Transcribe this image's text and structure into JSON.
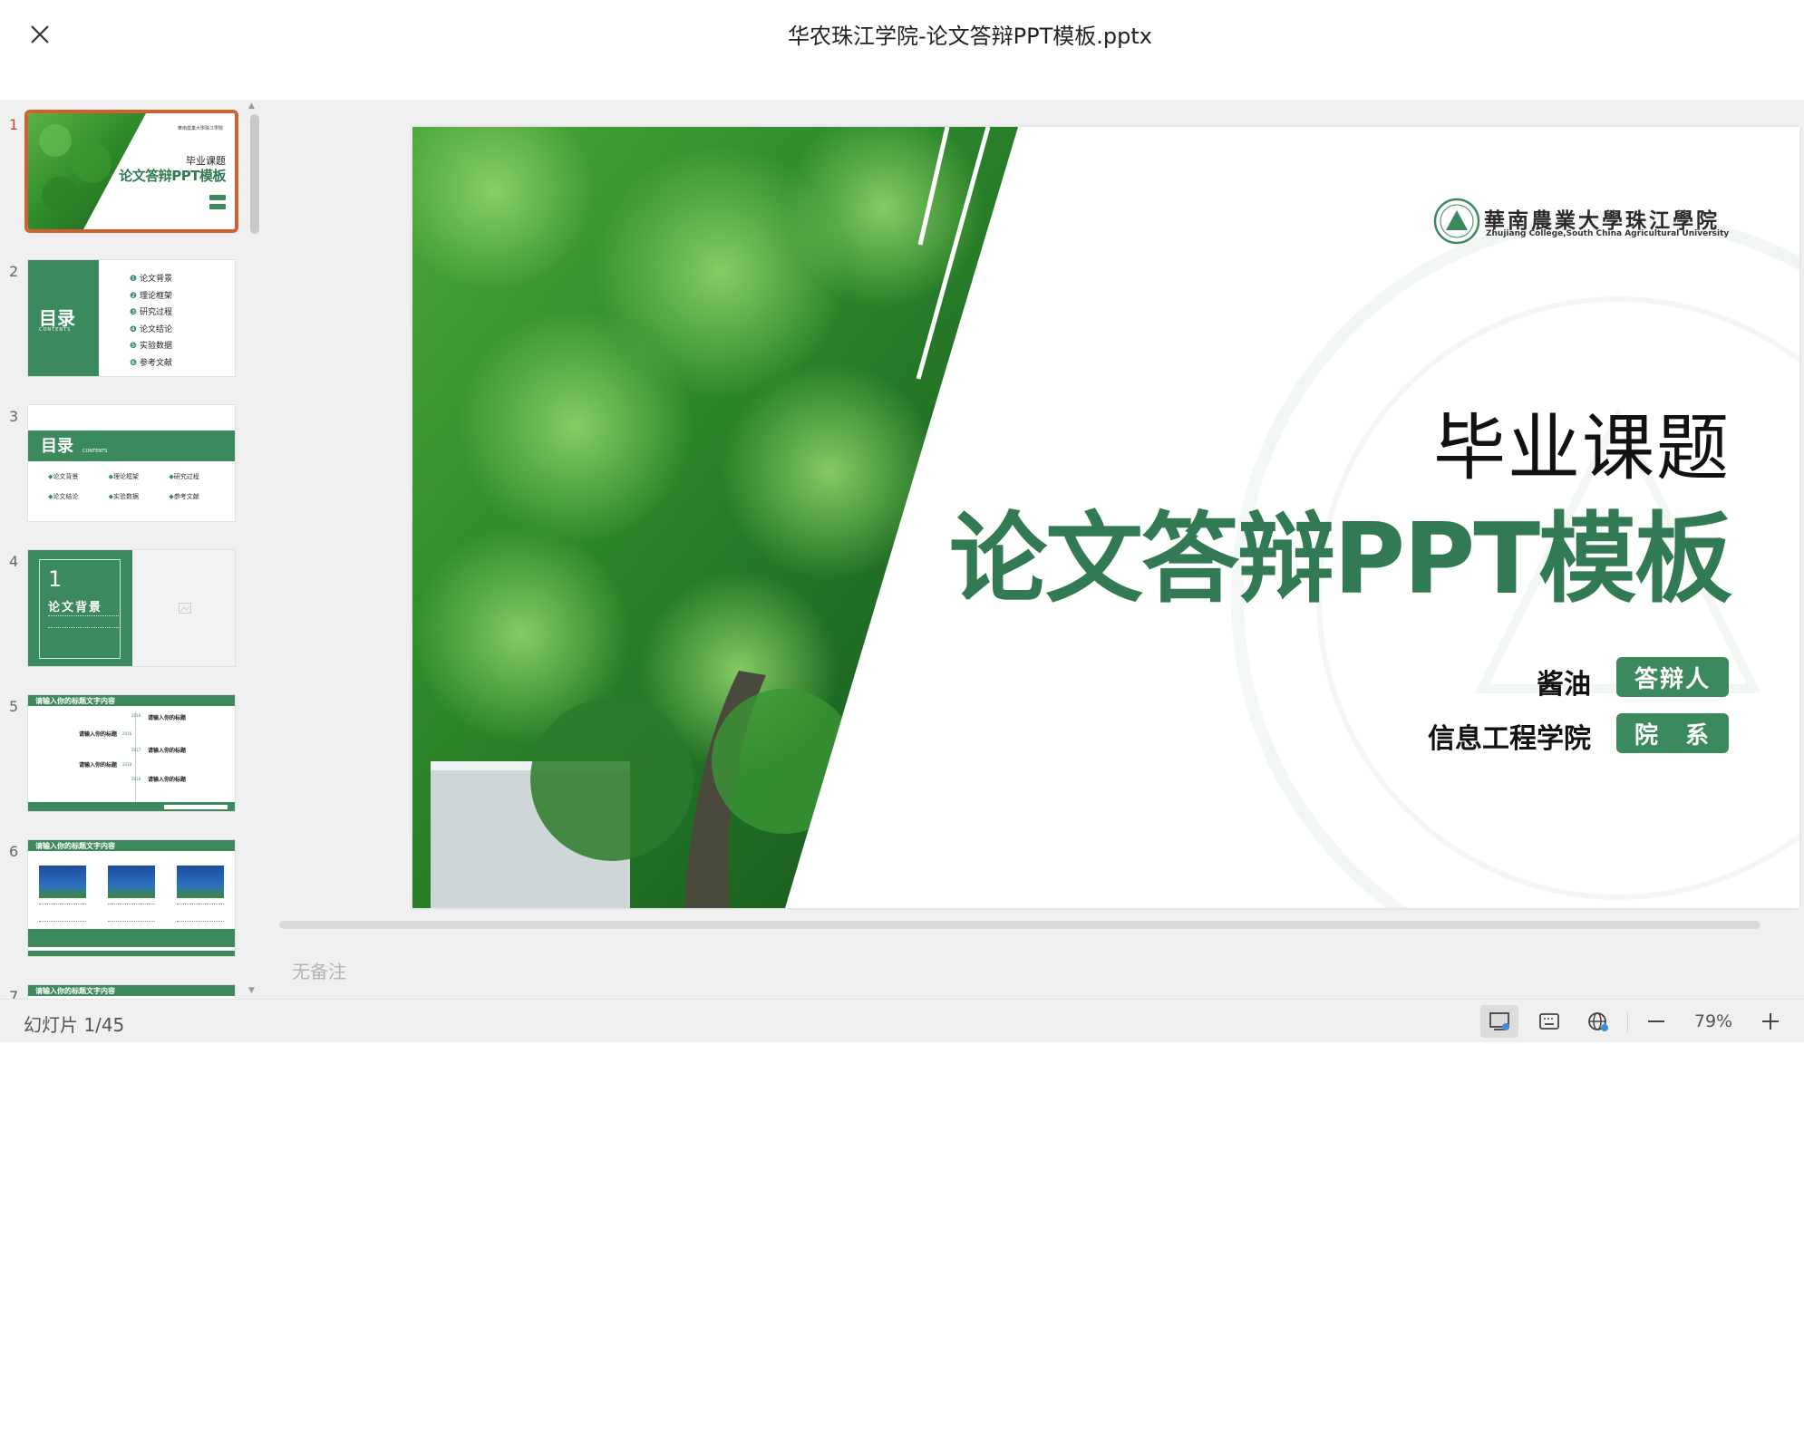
{
  "window": {
    "title": "华农珠江学院-论文答辩PPT模板.pptx",
    "close_icon": "close-icon"
  },
  "thumbnails": [
    {
      "num": "1",
      "label": "毕业课题",
      "title": "论文答辩PPT模板"
    },
    {
      "num": "2",
      "label": "目录",
      "sub": "CONTENTS",
      "items": [
        "论文背景",
        "理论框架",
        "研究过程",
        "论文结论",
        "实验数据",
        "参考文献"
      ]
    },
    {
      "num": "3",
      "label": "目录",
      "sub": "CONTENTS",
      "items": [
        "论文背景",
        "理论框架",
        "研究过程",
        "论文结论",
        "实验数据",
        "参考文献"
      ]
    },
    {
      "num": "4",
      "label": "1",
      "title": "论文背景"
    },
    {
      "num": "5",
      "header": "请输入你的标题文字内容",
      "years": [
        "2016",
        "2016",
        "2017",
        "2018",
        "2018"
      ],
      "item_title": "请输入你的标题"
    },
    {
      "num": "6",
      "header": "请输入你的标题文字内容"
    },
    {
      "num": "7",
      "header": "请输入你的标题文字内容"
    }
  ],
  "slide": {
    "logo_cn": "華南農業大學珠江學院",
    "logo_en": "Zhujiang College,South China Agricultural University",
    "subtitle": "毕业课题",
    "title": "论文答辩PPT模板",
    "rows": [
      {
        "value": "酱油",
        "badge": "答辩人"
      },
      {
        "value": "信息工程学院",
        "badge": "院　系"
      }
    ]
  },
  "notes": "无备注",
  "status": {
    "slide_count": "幻灯片 1/45",
    "zoom": "79%"
  },
  "colors": {
    "accent": "#3b8a5e",
    "selection": "#d2602f",
    "title_green": "#327a54"
  }
}
